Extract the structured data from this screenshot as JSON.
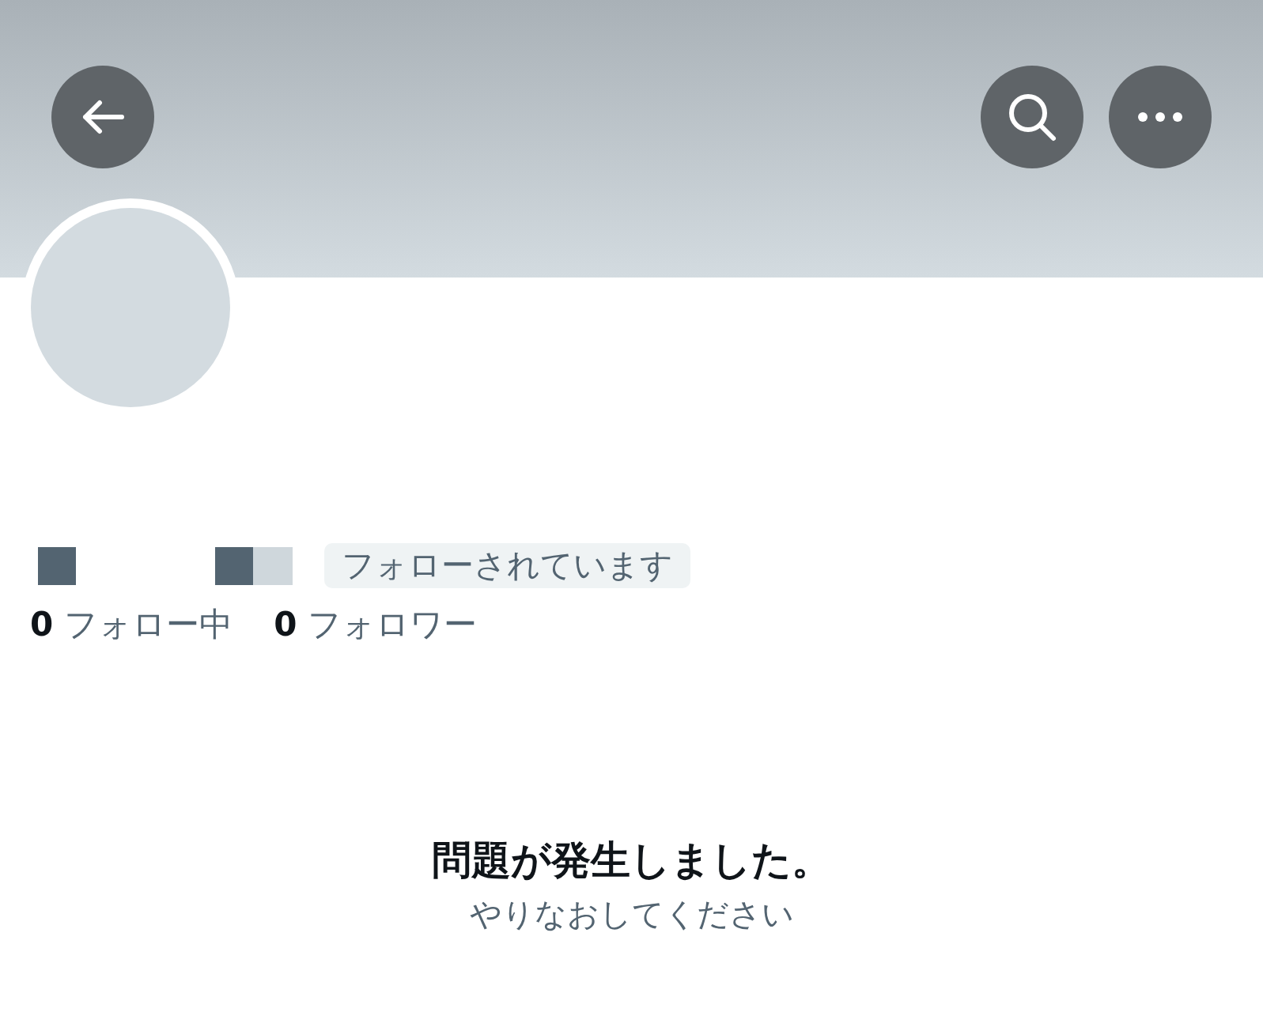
{
  "header": {
    "buttons": [
      {
        "kind": "back"
      },
      {
        "kind": "search"
      },
      {
        "kind": "more"
      }
    ]
  },
  "profile": {
    "follows_you_badge": "フォローされています",
    "stats": [
      {
        "count": "0",
        "label": "フォロー中"
      },
      {
        "count": "0",
        "label": "フォロワー"
      }
    ]
  },
  "error": {
    "title": "問題が発生しました。",
    "message": "やりなおしてください"
  }
}
